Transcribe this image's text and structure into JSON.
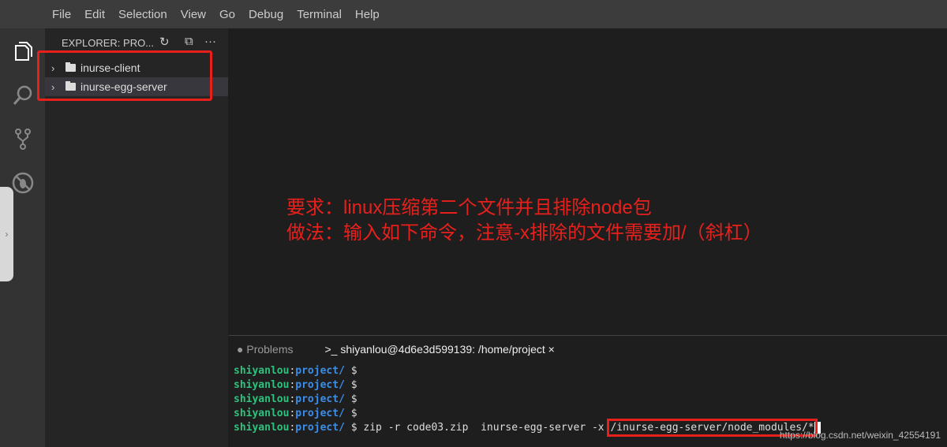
{
  "menu": [
    "File",
    "Edit",
    "Selection",
    "View",
    "Go",
    "Debug",
    "Terminal",
    "Help"
  ],
  "explorer": {
    "title": "EXPLORER: PRO...",
    "items": [
      "inurse-client",
      "inurse-egg-server"
    ]
  },
  "annotation": {
    "line1": "要求：linux压缩第二个文件并且排除node包",
    "line2": "做法：输入如下命令，注意-x排除的文件需要加/（斜杠）"
  },
  "panel": {
    "tab_problems": "Problems",
    "tab_terminal": "shiyanlou@4d6e3d599139: /home/project",
    "close": "×"
  },
  "terminal": {
    "user": "shiyanlou",
    "colon": ":",
    "path": "project/",
    "prompt": " $",
    "command": " zip -r code03.zip  inurse-egg-server -x ",
    "highlighted": "/inurse-egg-server/node_modules/*"
  },
  "watermark": "https://blog.csdn.net/weixin_42554191"
}
